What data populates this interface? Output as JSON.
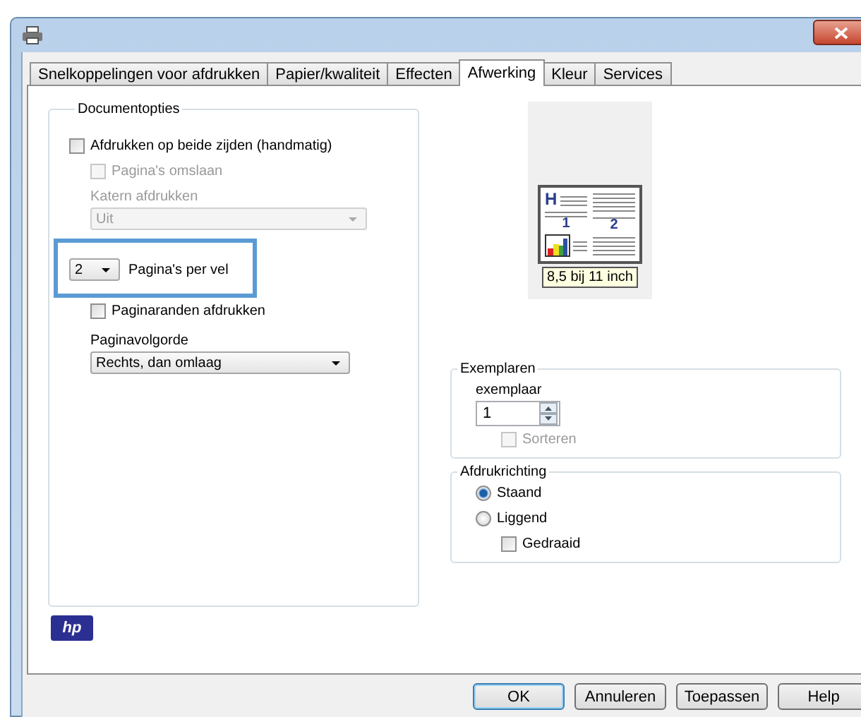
{
  "tabs": [
    {
      "label": "Snelkoppelingen voor afdrukken",
      "selected": false
    },
    {
      "label": "Papier/kwaliteit",
      "selected": false
    },
    {
      "label": "Effecten",
      "selected": false
    },
    {
      "label": "Afwerking",
      "selected": true
    },
    {
      "label": "Kleur",
      "selected": false
    },
    {
      "label": "Services",
      "selected": false
    }
  ],
  "document_options": {
    "title": "Documentopties",
    "duplex": {
      "label": "Afdrukken op beide zijden (handmatig)",
      "checked": false,
      "disabled": false
    },
    "flip_pages": {
      "label": "Pagina's omslaan",
      "checked": false,
      "disabled": true
    },
    "booklet": {
      "label": "Katern afdrukken",
      "value": "Uit",
      "disabled": true
    },
    "pages_per_sheet": {
      "value": "2",
      "label": "Pagina's per vel",
      "highlighted": true
    },
    "page_borders": {
      "label": "Paginaranden afdrukken",
      "checked": false,
      "disabled": false
    },
    "page_order": {
      "label": "Paginavolgorde",
      "value": "Rechts, dan omlaag"
    }
  },
  "preview": {
    "header_letter": "H",
    "page_numbers": [
      "1",
      "2"
    ],
    "size_label": "8,5 bij 11 inch"
  },
  "copies": {
    "title": "Exemplaren",
    "label": "exemplaar",
    "value": "1",
    "collate": {
      "label": "Sorteren",
      "checked": false,
      "disabled": true
    }
  },
  "orientation": {
    "title": "Afdrukrichting",
    "options": [
      {
        "label": "Staand",
        "selected": true
      },
      {
        "label": "Liggend",
        "selected": false
      }
    ],
    "rotated": {
      "label": "Gedraaid",
      "checked": false,
      "disabled": false
    }
  },
  "logo": "hp",
  "buttons": [
    {
      "label": "OK",
      "default": true
    },
    {
      "label": "Annuleren",
      "default": false
    },
    {
      "label": "Toepassen",
      "default": false
    },
    {
      "label": "Help",
      "default": false
    }
  ]
}
